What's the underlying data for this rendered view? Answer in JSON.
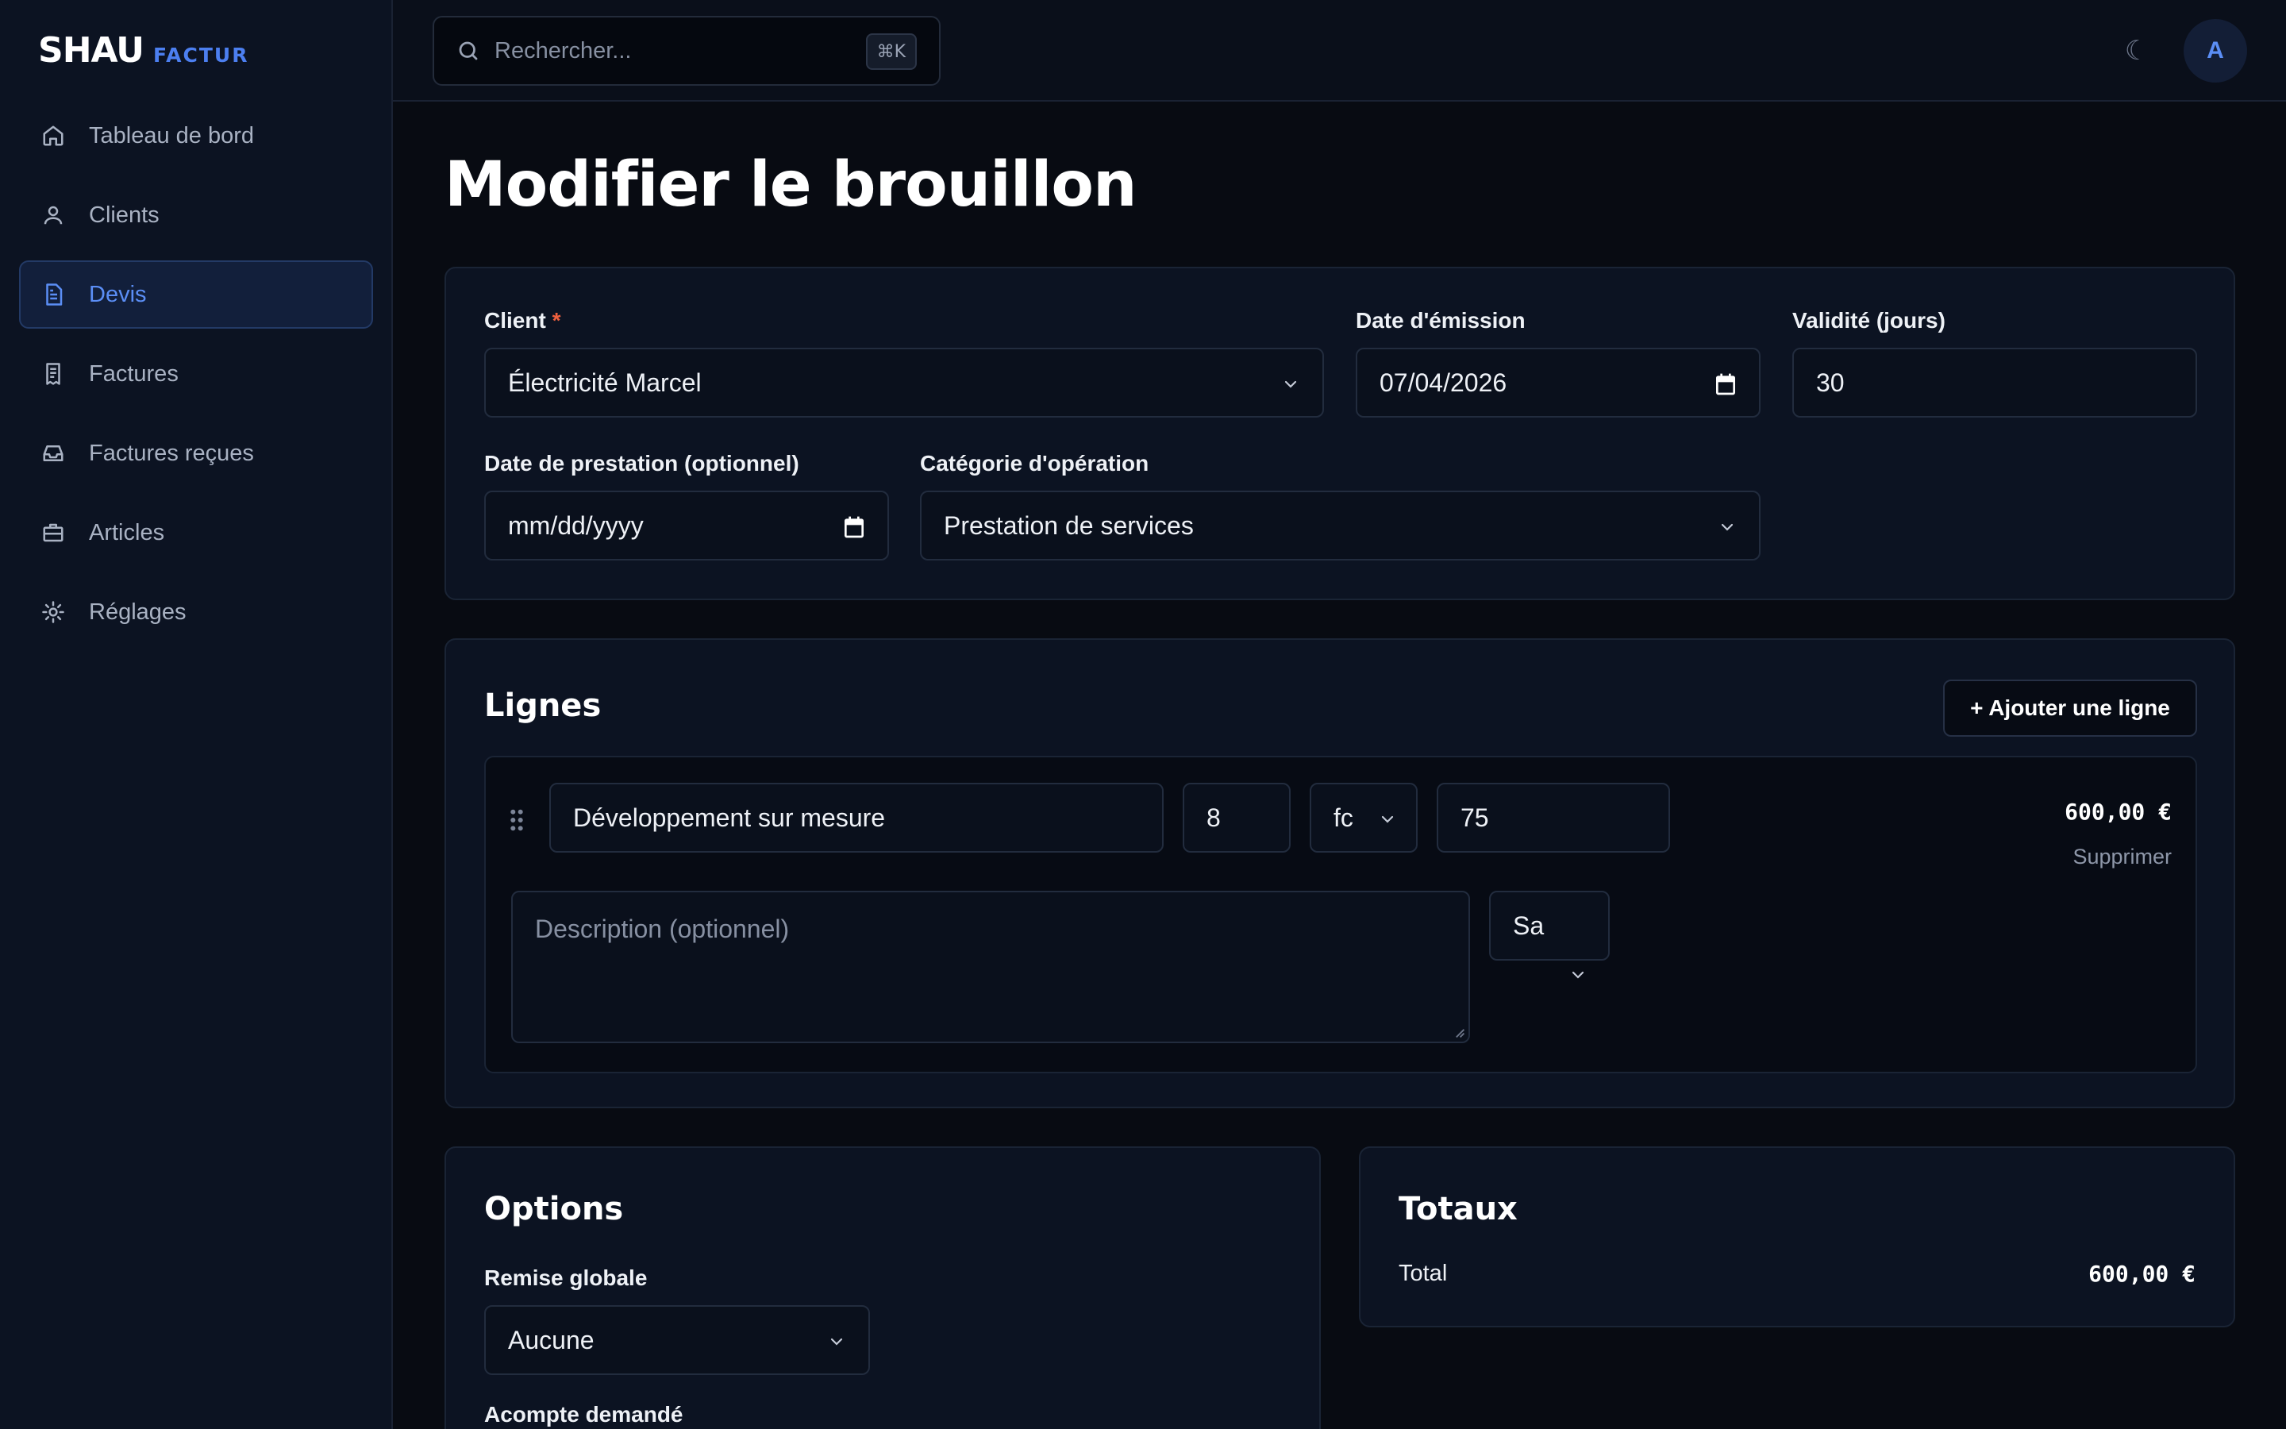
{
  "app": {
    "brand_main": "SHAU",
    "brand_sub": "FACTUR"
  },
  "sidebar": {
    "items": [
      {
        "label": "Tableau de bord",
        "icon": "home-icon"
      },
      {
        "label": "Clients",
        "icon": "user-icon"
      },
      {
        "label": "Devis",
        "icon": "document-icon",
        "active": true
      },
      {
        "label": "Factures",
        "icon": "receipt-icon"
      },
      {
        "label": "Factures reçues",
        "icon": "inbox-icon"
      },
      {
        "label": "Articles",
        "icon": "briefcase-icon"
      },
      {
        "label": "Réglages",
        "icon": "gear-icon"
      }
    ]
  },
  "topbar": {
    "search_placeholder": "Rechercher...",
    "search_shortcut": "⌘K",
    "theme_icon": "☾",
    "avatar_initial": "A"
  },
  "page": {
    "title": "Modifier le brouillon"
  },
  "form": {
    "client_label": "Client",
    "client_required_mark": "*",
    "client_value": "Électricité Marcel",
    "issue_date_label": "Date d'émission",
    "issue_date_value": "07/04/2026",
    "validity_label": "Validité (jours)",
    "validity_value": "30",
    "service_date_label": "Date de prestation (optionnel)",
    "service_date_placeholder": "mm/dd/yyyy",
    "category_label": "Catégorie d'opération",
    "category_value": "Prestation de services"
  },
  "lines": {
    "title": "Lignes",
    "add_button": "+ Ajouter une ligne",
    "items": [
      {
        "designation": "Développement sur mesure",
        "quantity": "8",
        "unit": "fc",
        "unit_price": "75",
        "amount": "600,00 €",
        "delete_label": "Supprimer",
        "description_placeholder": "Description (optionnel)",
        "vat": "Sa"
      }
    ]
  },
  "options": {
    "title": "Options",
    "discount_label": "Remise globale",
    "discount_value": "Aucune",
    "deposit_label": "Acompte demandé"
  },
  "totals": {
    "title": "Totaux",
    "total_label": "Total",
    "total_value": "600,00 €"
  },
  "colors": {
    "accent": "#5b8ef5",
    "background": "#080b12",
    "card": "#0c1322"
  }
}
